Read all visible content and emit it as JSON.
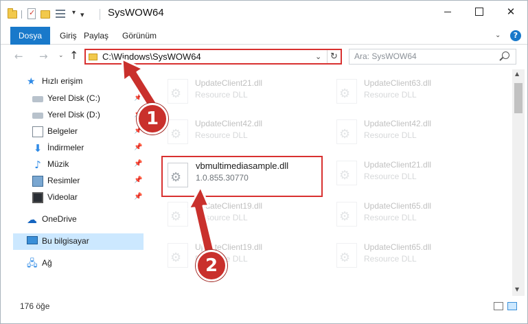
{
  "window": {
    "title": "SysWOW64"
  },
  "ribbon": {
    "file": "Dosya",
    "home": "Giriş",
    "share": "Paylaş",
    "view": "Görünüm"
  },
  "address": {
    "path": "C:\\Windows\\SysWOW64"
  },
  "search": {
    "placeholder": "Ara: SysWOW64"
  },
  "navpane": {
    "quick_access": "Hızlı erişim",
    "items": [
      {
        "label": "Yerel Disk (C:)",
        "icon": "drive-icon"
      },
      {
        "label": "Yerel Disk (D:)",
        "icon": "drive-icon"
      },
      {
        "label": "Belgeler",
        "icon": "documents-icon"
      },
      {
        "label": "İndirmeler",
        "icon": "downloads-icon"
      },
      {
        "label": "Müzik",
        "icon": "music-icon"
      },
      {
        "label": "Resimler",
        "icon": "pictures-icon"
      },
      {
        "label": "Videolar",
        "icon": "videos-icon"
      }
    ],
    "onedrive": "OneDrive",
    "this_pc": "Bu bilgisayar",
    "network": "Ağ"
  },
  "files": [
    {
      "name": "UpdateClient21.dll",
      "desc": "Resource DLL"
    },
    {
      "name": "UpdateClient63.dll",
      "desc": "Resource DLL"
    },
    {
      "name": "UpdateClient42.dll",
      "desc": "Resource DLL"
    },
    {
      "name": "UpdateClient42.dll",
      "desc": "Resource DLL"
    },
    {
      "name": "vbmultimediasample.dll",
      "desc": "1.0.855.30770"
    },
    {
      "name": "UpdateClient21.dll",
      "desc": "Resource DLL"
    },
    {
      "name": "UpdateClient19.dll",
      "desc": "Resource DLL"
    },
    {
      "name": "UpdateClient65.dll",
      "desc": "Resource DLL"
    },
    {
      "name": "UpdateClient19.dll",
      "desc": "Resource DLL"
    },
    {
      "name": "UpdateClient65.dll",
      "desc": "Resource DLL"
    }
  ],
  "callouts": {
    "one": "1",
    "two": "2"
  },
  "status": {
    "count": "176 öğe"
  },
  "colors": {
    "accent": "#1979ca",
    "highlight": "#d8302f",
    "selected": "#cce8ff"
  }
}
